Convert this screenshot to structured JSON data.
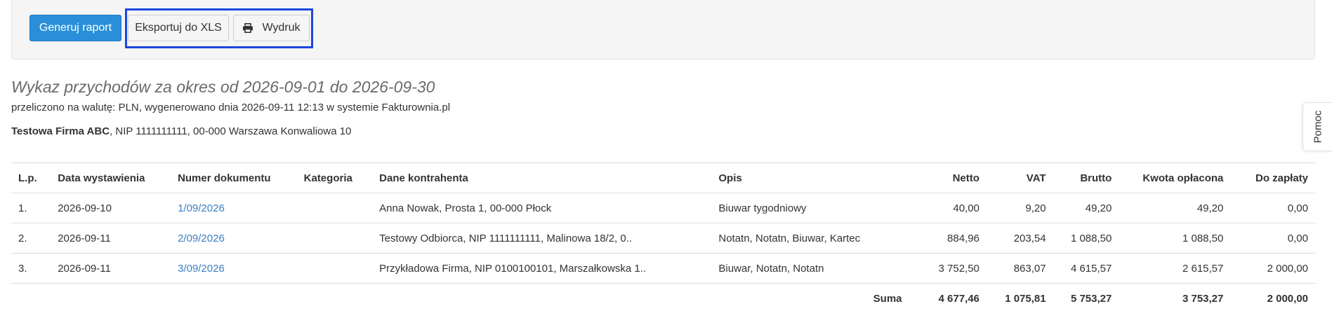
{
  "toolbar": {
    "generate_label": "Generuj raport",
    "export_label": "Eksportuj do XLS",
    "print_label": "Wydruk"
  },
  "report": {
    "title": "Wykaz przychodów za okres od 2026-09-01 do 2026-09-30",
    "subtitle": "przeliczono na walutę: PLN, wygenerowano dnia 2026-09-11 12:13 w systemie Fakturownia.pl",
    "company_name": "Testowa Firma ABC",
    "company_details": ", NIP 1111111111, 00-000 Warszawa Konwaliowa 10"
  },
  "help": {
    "label": "Pomoc"
  },
  "table": {
    "headers": {
      "lp": "L.p.",
      "date": "Data wystawienia",
      "doc": "Numer dokumentu",
      "category": "Kategoria",
      "client": "Dane kontrahenta",
      "desc": "Opis",
      "netto": "Netto",
      "vat": "VAT",
      "brutto": "Brutto",
      "paid": "Kwota opłacona",
      "due": "Do zapłaty"
    },
    "rows": [
      {
        "lp": "1.",
        "date": "2026-09-10",
        "doc": "1/09/2026",
        "category": "",
        "client": "Anna Nowak, Prosta 1, 00-000 Płock",
        "desc": "Biuwar tygodniowy",
        "netto": "40,00",
        "vat": "9,20",
        "brutto": "49,20",
        "paid": "49,20",
        "due": "0,00"
      },
      {
        "lp": "2.",
        "date": "2026-09-11",
        "doc": "2/09/2026",
        "category": "",
        "client": "Testowy Odbiorca, NIP 1111111111, Malinowa 18/2, 0..",
        "desc": "Notatn, Notatn, Biuwar, Kartec",
        "netto": "884,96",
        "vat": "203,54",
        "brutto": "1 088,50",
        "paid": "1 088,50",
        "due": "0,00"
      },
      {
        "lp": "3.",
        "date": "2026-09-11",
        "doc": "3/09/2026",
        "category": "",
        "client": "Przykładowa Firma, NIP 0100100101, Marszałkowska 1..",
        "desc": "Biuwar, Notatn, Notatn",
        "netto": "3 752,50",
        "vat": "863,07",
        "brutto": "4 615,57",
        "paid": "2 615,57",
        "due": "2 000,00"
      }
    ],
    "sum": {
      "label": "Suma",
      "netto": "4 677,46",
      "vat": "1 075,81",
      "brutto": "5 753,27",
      "paid": "3 753,27",
      "due": "2 000,00"
    }
  },
  "colors": {
    "primary": "#2a8fd8",
    "highlight": "#1a47e0",
    "link": "#3a7fc1"
  },
  "icons": {
    "print": "printer-icon"
  }
}
